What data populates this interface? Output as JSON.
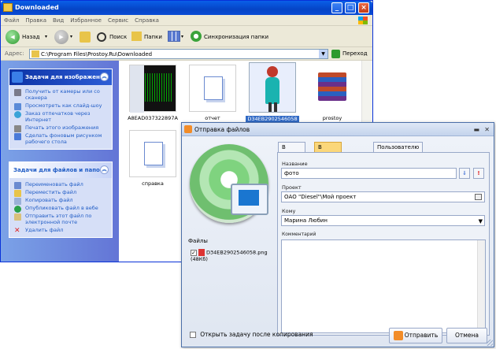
{
  "explorer": {
    "title": "Downloaded",
    "menu": [
      "Файл",
      "Правка",
      "Вид",
      "Избранное",
      "Сервис",
      "Справка"
    ],
    "toolbar": {
      "back": "Назад",
      "search": "Поиск",
      "folders": "Папки",
      "sync": "Синхронизация папки"
    },
    "address_label": "Адрес:",
    "address_value": "C:\\Program Files\\Prostoy.Ru\\Downloaded",
    "go_label": "Переход",
    "image_tasks": {
      "title": "Задачи для изображен",
      "items": [
        "Получить от камеры или со сканера",
        "Просмотреть как слайд-шоу",
        "Заказ отпечатков через Интернет",
        "Печать этого изображения",
        "Сделать фоновым рисунком рабочего стола"
      ]
    },
    "file_tasks": {
      "title": "Задачи для файлов и папок",
      "items": [
        "Переименовать файл",
        "Переместить файл",
        "Копировать файл",
        "Опубликовать файл в вебе",
        "Отправить этот файл по электронной почте",
        "Удалить файл"
      ]
    },
    "files": [
      "A8EAD037322897A",
      "отчет",
      "D34EB2902546058",
      "prostoy",
      "справка"
    ]
  },
  "dialog": {
    "title": "Отправка файлов",
    "tabs": [
      "В задачу",
      "В новую задачу",
      "Пользователю"
    ],
    "active_tab": "В новую задачу",
    "name_label": "Название",
    "name_value": "фото",
    "project_label": "Проект",
    "project_value": "ОАО \"Diesel\"\\Мой проект",
    "to_label": "Кому",
    "to_value": "Марина Любин",
    "comment_label": "Комментарий",
    "files_label": "Файлы",
    "attachment": "D34EB2902546058.png (48Кб)",
    "open_after_label": "Открыть задачу после копирования",
    "send_label": "Отправить",
    "cancel_label": "Отмена"
  }
}
